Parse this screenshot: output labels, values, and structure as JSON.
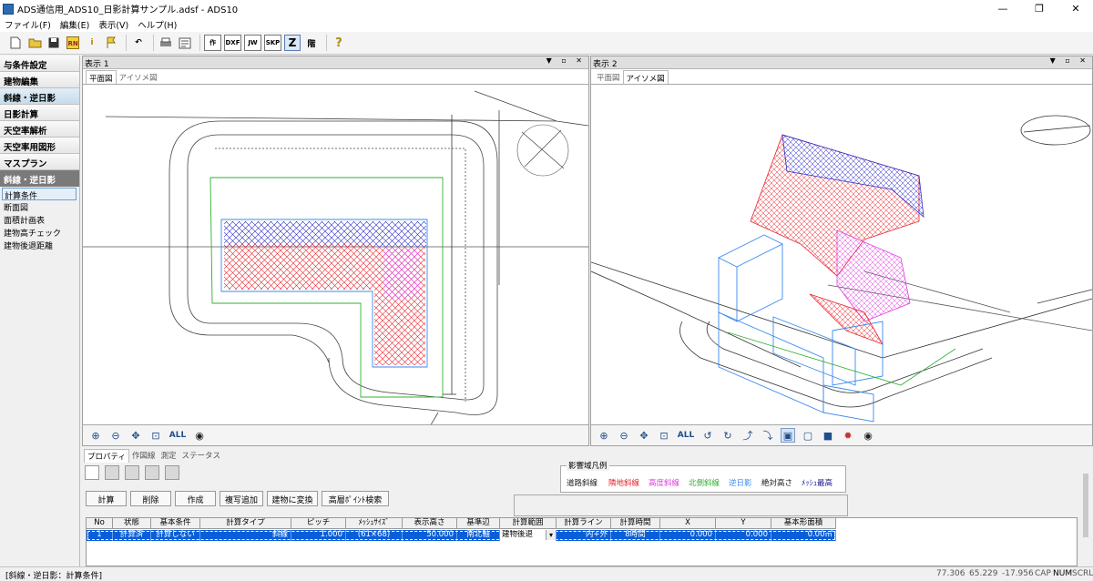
{
  "window": {
    "title": "ADS通信用_ADS10_日影計算サンプル.adsf - ADS10",
    "minimize": "—",
    "maximize": "❐",
    "close": "✕"
  },
  "menu": [
    "ファイル(F)",
    "編集(E)",
    "表示(V)",
    "ヘルプ(H)"
  ],
  "toolbar": {
    "icons": [
      "new-file-icon",
      "open-folder-icon",
      "save-icon",
      "rn-icon",
      "info-icon",
      "flag-icon",
      "undo-icon",
      "print-icon",
      "print-preview-icon"
    ],
    "labels": {
      "sakusei": "作",
      "dxf": "DXF",
      "jw": "JW",
      "skp": "SKP",
      "z": "Z",
      "kai": "階",
      "help": "?"
    }
  },
  "sidebar": {
    "buttons": [
      "与条件設定",
      "建物編集",
      "斜線・逆日影",
      "日影計算",
      "天空率解析",
      "天空率用図形",
      "マスプラン"
    ],
    "selected_button": "斜線・逆日影",
    "section_header": "斜線・逆日影",
    "items": [
      "計算条件",
      "断面図",
      "面積計画表",
      "建物高チェック",
      "建物後退距離"
    ],
    "selected_item": "計算条件"
  },
  "view1": {
    "title": "表示 1",
    "tabs": [
      "平面図",
      "アイソメ図"
    ],
    "active_tab": "平面図",
    "all_label": "ALL",
    "controls": "▼ ▫ ✕"
  },
  "view2": {
    "title": "表示 2",
    "tabs": [
      "平面図",
      "アイソメ図"
    ],
    "active_tab": "アイソメ図",
    "all_label": "ALL",
    "controls": "▼ ▫ ✕"
  },
  "bottom": {
    "tabs": [
      "プロパティ",
      "作図線",
      "測定",
      "ステータス"
    ],
    "active_tab": "プロパティ",
    "actions": [
      "計算",
      "削除",
      "作成",
      "複写追加",
      "建物に変換",
      "高層ﾎﾟｲﾝﾄ検索"
    ],
    "legend": {
      "title": "影響域凡例",
      "items": [
        {
          "label": "道路斜線",
          "color": "#202020"
        },
        {
          "label": "隣地斜線",
          "color": "#e8242c"
        },
        {
          "label": "高度斜線",
          "color": "#e03ce0"
        },
        {
          "label": "北側斜線",
          "color": "#30b030"
        },
        {
          "label": "逆日影",
          "color": "#3a8af0"
        },
        {
          "label": "絶対高さ",
          "color": "#202020"
        },
        {
          "label": "ﾒｯｼｭ最高",
          "color": "#202090"
        }
      ]
    },
    "table": {
      "headers": [
        "No",
        "状態",
        "基本条件",
        "計算タイプ",
        "ピッチ",
        "ﾒｯｼｭｻｲｽﾞ",
        "表示高さ",
        "基準辺",
        "計算範囲",
        "計算ライン",
        "計算時間",
        "X",
        "Y",
        "基本形面積"
      ],
      "rows": [
        [
          "1",
          "計算済",
          "計算しない",
          "斜線",
          "1.000",
          "(61×68)",
          "50.000",
          "南北軸",
          "建物後退",
          "内+外",
          "8時間",
          "0.000",
          "0.000",
          "0.00㎡"
        ]
      ]
    }
  },
  "status": {
    "left": "[斜線・逆日影：計算条件]",
    "coords": [
      "77.306",
      "65.229",
      "-17.956"
    ],
    "keys": [
      "CAP",
      "NUM",
      "SCRL"
    ]
  },
  "colors": {
    "red": "#e8242c",
    "blue": "#2a2acb",
    "magenta": "#e03ce0",
    "green": "#30b030",
    "lightblue": "#3a8af0",
    "selection": "#0a5fd8"
  }
}
